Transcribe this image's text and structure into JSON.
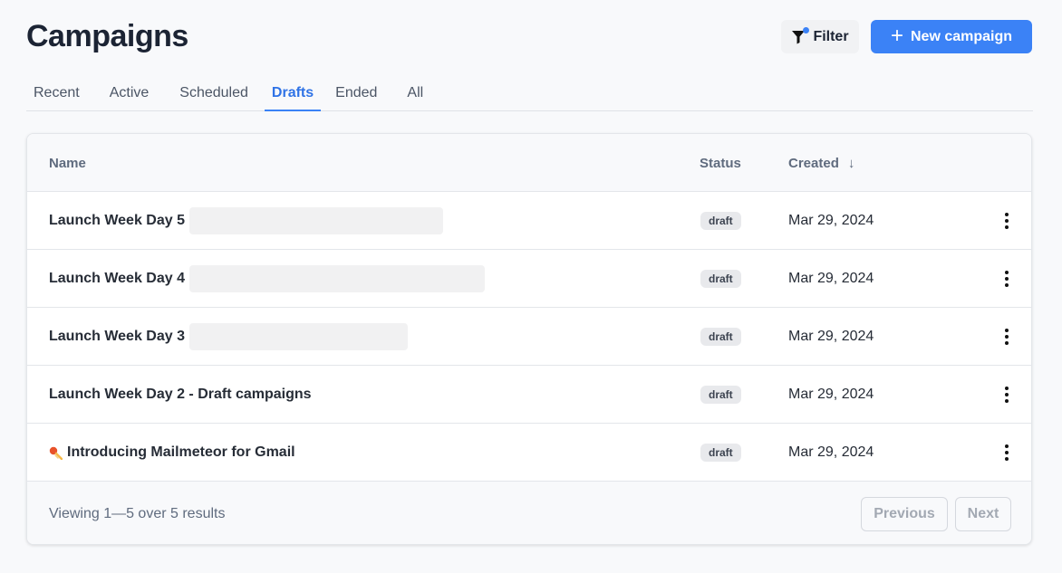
{
  "header": {
    "title": "Campaigns",
    "filter_label": "Filter",
    "new_campaign_label": "New campaign",
    "accent_color": "#3b82f6"
  },
  "tabs": [
    {
      "label": "Recent",
      "active": false
    },
    {
      "label": "Active",
      "active": false
    },
    {
      "label": "Scheduled",
      "active": false
    },
    {
      "label": "Drafts",
      "active": true
    },
    {
      "label": "Ended",
      "active": false
    },
    {
      "label": "All",
      "active": false
    }
  ],
  "table": {
    "columns": {
      "name": "Name",
      "status": "Status",
      "created": "Created",
      "created_sort_icon": "arrow-down-icon"
    },
    "rows": [
      {
        "name": "Launch Week Day 5",
        "status": "draft",
        "created": "Mar 29, 2024",
        "icon": ""
      },
      {
        "name": "Launch Week Day 4",
        "status": "draft",
        "created": "Mar 29, 2024",
        "icon": ""
      },
      {
        "name": "Launch Week Day 3",
        "status": "draft",
        "created": "Mar 29, 2024",
        "icon": ""
      },
      {
        "name": "Launch Week Day 2 - Draft campaigns",
        "status": "draft",
        "created": "Mar 29, 2024",
        "icon": ""
      },
      {
        "name": "Introducing Mailmeteor for Gmail",
        "status": "draft",
        "created": "Mar 29, 2024",
        "icon": "meteor-icon"
      }
    ]
  },
  "footer": {
    "summary": "Viewing 1—5 over 5 results",
    "previous_label": "Previous",
    "next_label": "Next"
  }
}
